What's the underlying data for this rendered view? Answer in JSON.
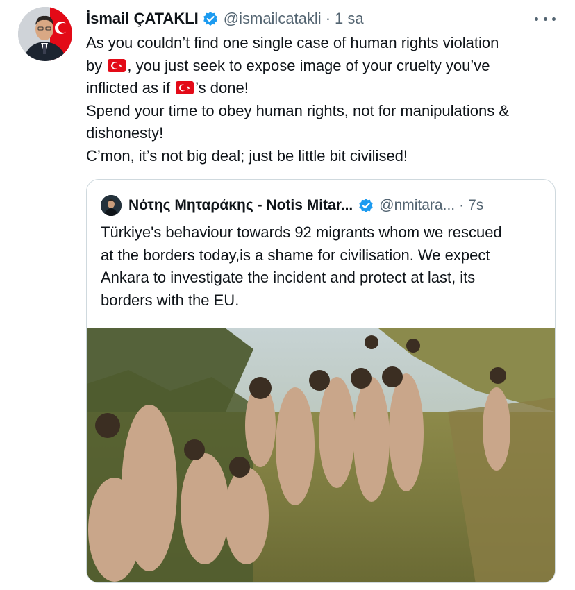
{
  "tweet": {
    "author_name": "İsmail ÇATAKLI",
    "handle": "@ismailcatakli",
    "separator": "·",
    "time": "1 sa",
    "lines": [
      {
        "before": "As you couldn’t find one single case of human rights violation",
        "after": ""
      },
      {
        "before": "by ",
        "after": ", you just seek to expose image of your cruelty you’ve"
      },
      {
        "before": "inflicted as if ",
        "after": "’s done!"
      },
      {
        "before": "Spend your time to obey human rights, not for manipulations &",
        "after": ""
      },
      {
        "before": "dishonesty!",
        "after": ""
      },
      {
        "before": "C’mon, it’s not big deal; just be little bit civilised!",
        "after": ""
      }
    ],
    "flag_icon": "turkey-flag-icon"
  },
  "quoted": {
    "author_name": "Νότης Μηταράκης - Notis Mitar...",
    "handle": "@nmitara...",
    "separator": "·",
    "time": "7s",
    "lines": [
      "Türkiye's behaviour towards 92 migrants whom we rescued",
      "at the borders today,is a shame for civilisation. We expect",
      "Ankara to investigate the incident and protect at last, its",
      "borders with the EU."
    ]
  },
  "colors": {
    "text": "#0f1419",
    "secondary": "#536471",
    "verified": "#1d9bf0",
    "border": "#cfd9de",
    "flag_red": "#e30a17"
  }
}
